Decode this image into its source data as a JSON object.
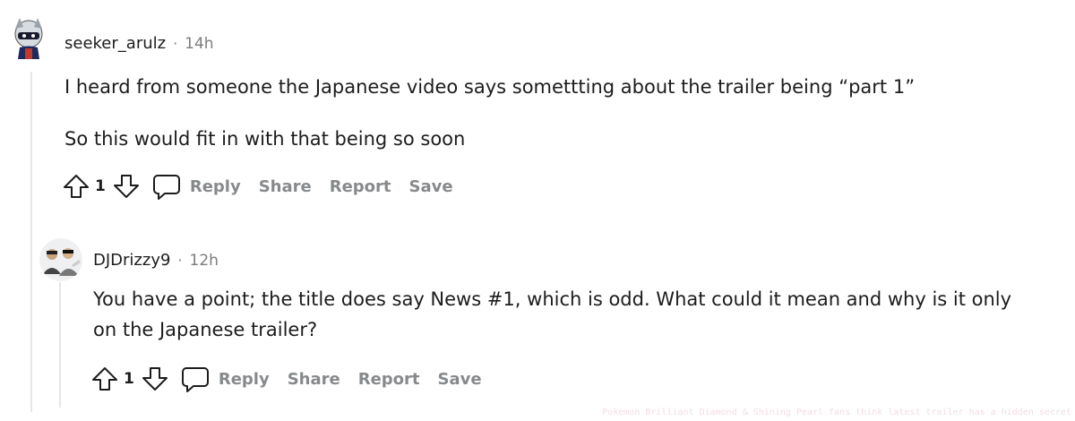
{
  "comments": [
    {
      "username": "seeker_arulz",
      "separator": "·",
      "time": "14h",
      "paragraphs": [
        "I heard from someone the Japanese video says somettting about the trailer being “part 1”",
        "So this would fit in with that being so soon"
      ],
      "votes": "1",
      "actions": {
        "reply": "Reply",
        "share": "Share",
        "report": "Report",
        "save": "Save"
      }
    },
    {
      "username": "DJDrizzy9",
      "separator": "·",
      "time": "12h",
      "paragraphs": [
        "You have a point; the title does say News #1, which is odd. What could it mean and why is it only",
        "on the Japanese trailer?"
      ],
      "votes": "1",
      "actions": {
        "reply": "Reply",
        "share": "Share",
        "report": "Report",
        "save": "Save"
      }
    }
  ],
  "watermark": "Pokemon Brilliant Diamond & Shining Pearl fans think latest trailer has a hidden secret",
  "colors": {
    "muted": "#878a8c",
    "thread_line": "#e4e6e8",
    "text": "#1c1c1c"
  }
}
